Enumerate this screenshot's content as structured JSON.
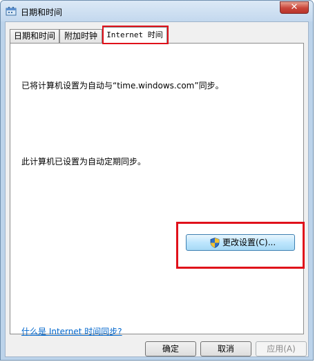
{
  "window": {
    "title": "日期和时间",
    "close_glyph": "✕"
  },
  "tabs": [
    {
      "label": "日期和时间",
      "active": false
    },
    {
      "label": "附加时钟",
      "active": false
    },
    {
      "label": "Internet 时间",
      "active": true
    }
  ],
  "internet_time": {
    "status_text": "已将计算机设置为自动与“time.windows.com”同步。",
    "sync_text": "此计算机已设置为自动定期同步。",
    "change_settings_button": "更改设置(C)...",
    "help_link": "什么是 Internet 时间同步?"
  },
  "buttons": {
    "ok": "确定",
    "cancel": "取消",
    "apply": "应用(A)"
  },
  "colors": {
    "highlight": "#e0101a",
    "link": "#0066cc",
    "titlebar": "#c3d8ee"
  },
  "icons": {
    "title": "clock-icon",
    "shield": "uac-shield-icon"
  }
}
